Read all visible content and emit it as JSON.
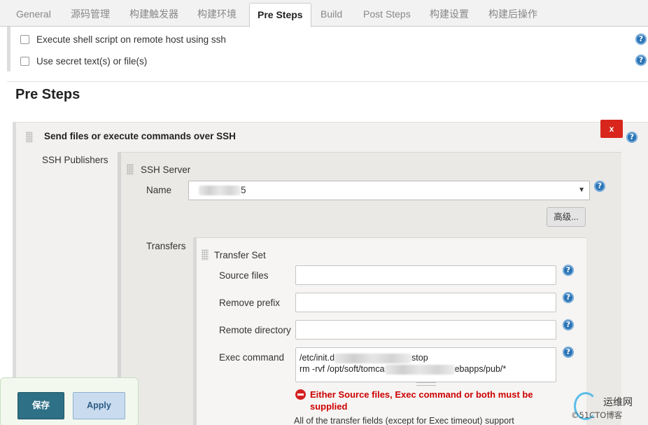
{
  "tabs": [
    {
      "label": "General",
      "active": false
    },
    {
      "label": "源码管理",
      "active": false
    },
    {
      "label": "构建触发器",
      "active": false
    },
    {
      "label": "构建环境",
      "active": false
    },
    {
      "label": "Pre Steps",
      "active": true
    },
    {
      "label": "Build",
      "active": false
    },
    {
      "label": "Post Steps",
      "active": false
    },
    {
      "label": "构建设置",
      "active": false
    },
    {
      "label": "构建后操作",
      "active": false
    }
  ],
  "env_options": [
    {
      "label": "Execute shell script on remote host using ssh",
      "checked": false
    },
    {
      "label": "Use secret text(s) or file(s)",
      "checked": false
    }
  ],
  "help_glyph": "?",
  "section_title": "Pre Steps",
  "step": {
    "title": "Send files or execute commands over SSH",
    "delete_label": "x",
    "publishers_label": "SSH Publishers",
    "server": {
      "title": "SSH Server",
      "name_label": "Name",
      "name_value_visible": "5",
      "select_arrow": "▼",
      "advanced_label": "高级..."
    },
    "transfers_label": "Transfers",
    "transfer_set": {
      "title": "Transfer Set",
      "source_files_label": "Source files",
      "source_files_value": "",
      "remove_prefix_label": "Remove prefix",
      "remove_prefix_value": "",
      "remote_directory_label": "Remote directory",
      "remote_directory_value": "",
      "exec_command_label": "Exec command",
      "exec_line1_start": "/etc/init.d",
      "exec_line1_end": "stop",
      "exec_line2_start": "rm -rvf /opt/soft/tomca",
      "exec_line2_end": "ebapps/pub/*",
      "error_text": "Either Source files, Exec command or both must be supplied",
      "note_text": "All of the transfer fields (except for Exec timeout) support"
    }
  },
  "actions": {
    "save_label": "保存",
    "apply_label": "Apply"
  },
  "watermark": {
    "line1": "运维网",
    "line2": "©51CTO博客"
  },
  "colors": {
    "delete_button": "#d9261c",
    "help_icon": "#2b74b5",
    "save_button": "#2e7086",
    "apply_button": "#c9dcef",
    "error_text": "#cc0000"
  }
}
